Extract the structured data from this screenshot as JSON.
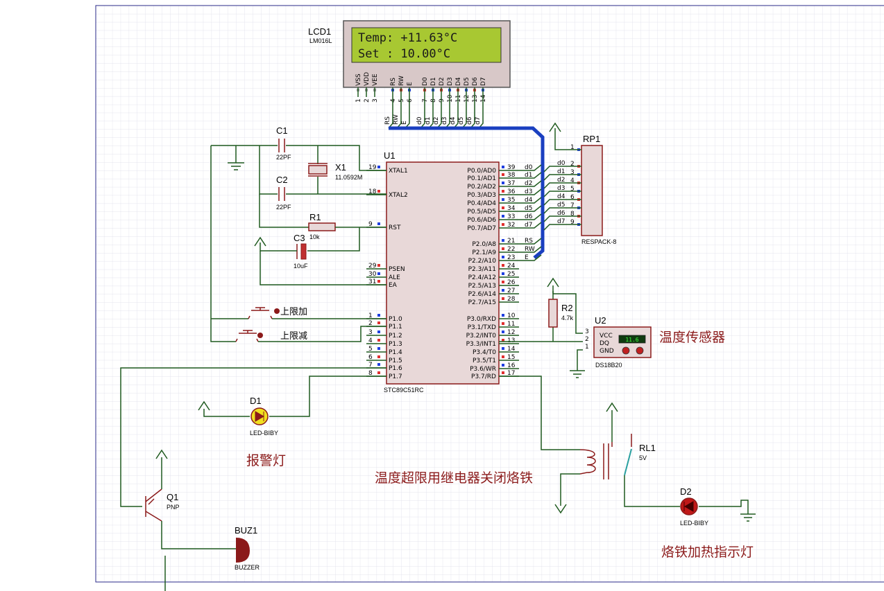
{
  "lcd": {
    "ref": "LCD1",
    "model": "LM016L",
    "line1": "Temp: +11.63°C",
    "line2": "Set :  10.00°C",
    "pins": [
      "VSS",
      "VDD",
      "VEE",
      "RS",
      "RW",
      "E",
      "D0",
      "D1",
      "D2",
      "D3",
      "D4",
      "D5",
      "D6",
      "D7"
    ],
    "pin_numbers": [
      "1",
      "2",
      "3",
      "4",
      "5",
      "6",
      "7",
      "8",
      "9",
      "10",
      "11",
      "12",
      "13",
      "14"
    ],
    "bus_labels": [
      "RS",
      "RW",
      "E",
      "d0",
      "d1",
      "d2",
      "d3",
      "d4",
      "d5",
      "d6",
      "d7"
    ]
  },
  "mcu": {
    "ref": "U1",
    "model": "STC89C51RC",
    "left_pins": [
      {
        "num": "19",
        "name": "XTAL1"
      },
      {
        "num": "18",
        "name": "XTAL2"
      },
      {
        "num": "9",
        "name": "RST"
      },
      {
        "num": "29",
        "name": "PSEN"
      },
      {
        "num": "30",
        "name": "ALE"
      },
      {
        "num": "31",
        "name": "EA"
      },
      {
        "num": "1",
        "name": "P1.0"
      },
      {
        "num": "2",
        "name": "P1.1"
      },
      {
        "num": "3",
        "name": "P1.2"
      },
      {
        "num": "4",
        "name": "P1.3"
      },
      {
        "num": "5",
        "name": "P1.4"
      },
      {
        "num": "6",
        "name": "P1.5"
      },
      {
        "num": "7",
        "name": "P1.6"
      },
      {
        "num": "8",
        "name": "P1.7"
      }
    ],
    "right_pins": [
      {
        "num": "39",
        "name": "P0.0/AD0",
        "net": "d0"
      },
      {
        "num": "38",
        "name": "P0.1/AD1",
        "net": "d1"
      },
      {
        "num": "37",
        "name": "P0.2/AD2",
        "net": "d2"
      },
      {
        "num": "36",
        "name": "P0.3/AD3",
        "net": "d3"
      },
      {
        "num": "35",
        "name": "P0.4/AD4",
        "net": "d4"
      },
      {
        "num": "34",
        "name": "P0.5/AD5",
        "net": "d5"
      },
      {
        "num": "33",
        "name": "P0.6/AD6",
        "net": "d6"
      },
      {
        "num": "32",
        "name": "P0.7/AD7",
        "net": "d7"
      },
      {
        "num": "21",
        "name": "P2.0/A8",
        "net": "RS"
      },
      {
        "num": "22",
        "name": "P2.1/A9",
        "net": "RW"
      },
      {
        "num": "23",
        "name": "P2.2/A10",
        "net": "E"
      },
      {
        "num": "24",
        "name": "P2.3/A11",
        "net": ""
      },
      {
        "num": "25",
        "name": "P2.4/A12",
        "net": ""
      },
      {
        "num": "26",
        "name": "P2.5/A13",
        "net": ""
      },
      {
        "num": "27",
        "name": "P2.6/A14",
        "net": ""
      },
      {
        "num": "28",
        "name": "P2.7/A15",
        "net": ""
      },
      {
        "num": "10",
        "name": "P3.0/RXD",
        "net": ""
      },
      {
        "num": "11",
        "name": "P3.1/TXD",
        "net": ""
      },
      {
        "num": "12",
        "name": "P3.2/INT0",
        "net": ""
      },
      {
        "num": "13",
        "name": "P3.3/INT1",
        "net": ""
      },
      {
        "num": "14",
        "name": "P3.4/T0",
        "net": ""
      },
      {
        "num": "15",
        "name": "P3.5/T1",
        "net": ""
      },
      {
        "num": "16",
        "name": "P3.6/WR",
        "net": ""
      },
      {
        "num": "17",
        "name": "P3.7/RD",
        "net": ""
      }
    ]
  },
  "rp1": {
    "ref": "RP1",
    "model": "RESPACK-8",
    "pins": [
      "1",
      "2",
      "3",
      "4",
      "5",
      "6",
      "7",
      "8",
      "9"
    ],
    "nets": [
      "d0",
      "d1",
      "d2",
      "d3",
      "d4",
      "d5",
      "d6",
      "d7"
    ]
  },
  "c1": {
    "ref": "C1",
    "value": "22PF"
  },
  "c2": {
    "ref": "C2",
    "value": "22PF"
  },
  "c3": {
    "ref": "C3",
    "value": "10uF"
  },
  "x1": {
    "ref": "X1",
    "value": "11.0592M"
  },
  "r1": {
    "ref": "R1",
    "value": "10k"
  },
  "r2": {
    "ref": "R2",
    "value": "4.7k"
  },
  "u2": {
    "ref": "U2",
    "model": "DS18B20",
    "pins": [
      "VCC",
      "DQ",
      "GND"
    ],
    "pin_numbers": [
      "3",
      "2",
      "1"
    ],
    "display": "11.6"
  },
  "d1": {
    "ref": "D1",
    "model": "LED-BIBY"
  },
  "d2": {
    "ref": "D2",
    "model": "LED-BIBY"
  },
  "q1": {
    "ref": "Q1",
    "model": "PNP"
  },
  "buz1": {
    "ref": "BUZ1",
    "model": "BUZZER"
  },
  "rl1": {
    "ref": "RL1",
    "value": "5V"
  },
  "labels": {
    "btn_up": "上限加",
    "btn_down": "上限减",
    "sensor": "温度传感器",
    "alarm": "报警灯",
    "relay_note": "温度超限用继电器关闭烙铁",
    "heat_lamp": "烙铁加热指示灯"
  },
  "colors": {
    "wire": "#1f5a1f",
    "component": "#8b1a1a",
    "bus": "#1a3fc0",
    "lcd_screen": "#a8c832",
    "pin_red": "#e03030",
    "pin_blue": "#2040e0",
    "grid": "#d8d8e8"
  }
}
